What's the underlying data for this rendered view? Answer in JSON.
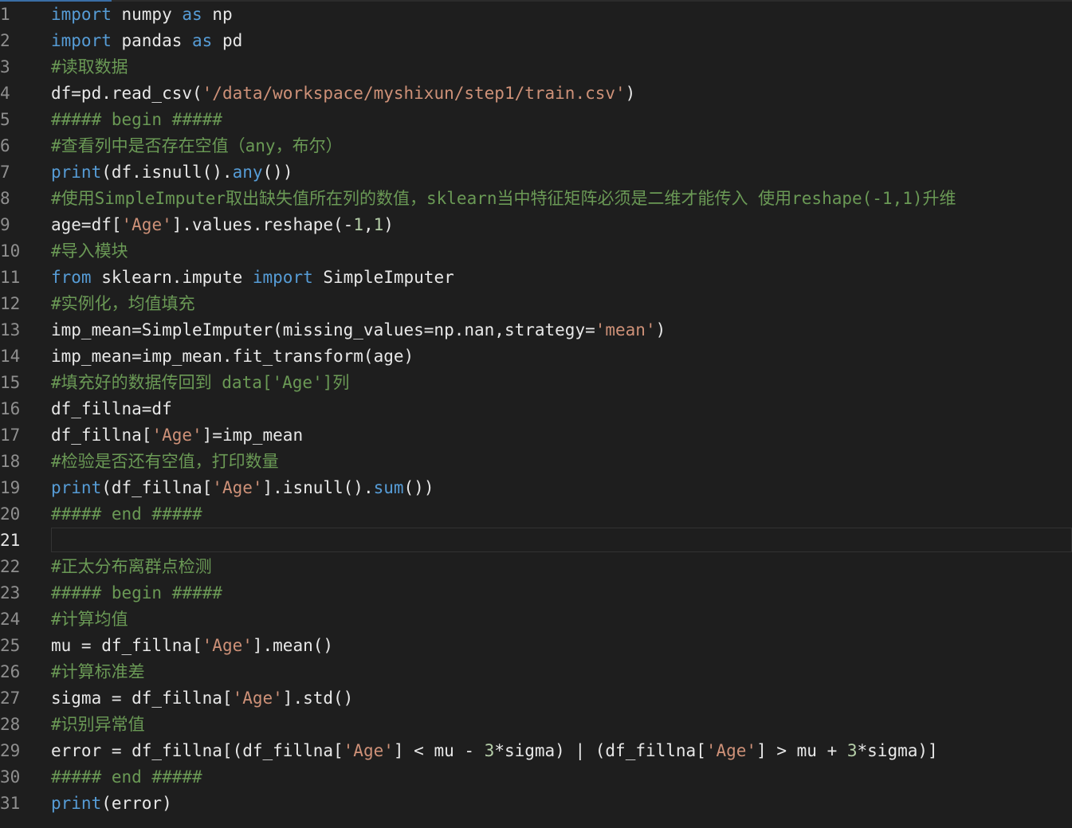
{
  "editor": {
    "current_line": 21,
    "lines": [
      {
        "n": "1",
        "tokens": [
          [
            "kw",
            "import"
          ],
          [
            "plain",
            " numpy "
          ],
          [
            "kw",
            "as"
          ],
          [
            "plain",
            " np"
          ]
        ]
      },
      {
        "n": "2",
        "tokens": [
          [
            "kw",
            "import"
          ],
          [
            "plain",
            " pandas "
          ],
          [
            "kw",
            "as"
          ],
          [
            "plain",
            " pd"
          ]
        ]
      },
      {
        "n": "3",
        "tokens": [
          [
            "cm",
            "#读取数据"
          ]
        ]
      },
      {
        "n": "4",
        "tokens": [
          [
            "plain",
            "df=pd.read_csv("
          ],
          [
            "str",
            "'/data/workspace/myshixun/step1/train.csv'"
          ],
          [
            "plain",
            ")"
          ]
        ]
      },
      {
        "n": "5",
        "tokens": [
          [
            "cm",
            "##### begin #####"
          ]
        ]
      },
      {
        "n": "6",
        "tokens": [
          [
            "cm",
            "#查看列中是否存在空值（any，布尔）"
          ]
        ]
      },
      {
        "n": "7",
        "tokens": [
          [
            "fn",
            "print"
          ],
          [
            "plain",
            "(df.isnull()."
          ],
          [
            "fn",
            "any"
          ],
          [
            "plain",
            "())"
          ]
        ]
      },
      {
        "n": "8",
        "tokens": [
          [
            "cm",
            "#使用SimpleImputer取出缺失值所在列的数值，sklearn当中特征矩阵必须是二维才能传入 使用reshape(-1,1)升维"
          ]
        ]
      },
      {
        "n": "9",
        "tokens": [
          [
            "plain",
            "age=df["
          ],
          [
            "str",
            "'Age'"
          ],
          [
            "plain",
            "].values.reshape(-"
          ],
          [
            "num",
            "1"
          ],
          [
            "plain",
            ","
          ],
          [
            "num",
            "1"
          ],
          [
            "plain",
            ")"
          ]
        ]
      },
      {
        "n": "10",
        "tokens": [
          [
            "cm",
            "#导入模块"
          ]
        ]
      },
      {
        "n": "11",
        "tokens": [
          [
            "kw",
            "from"
          ],
          [
            "plain",
            " sklearn.impute "
          ],
          [
            "kw",
            "import"
          ],
          [
            "plain",
            " SimpleImputer"
          ]
        ]
      },
      {
        "n": "12",
        "tokens": [
          [
            "cm",
            "#实例化，均值填充"
          ]
        ]
      },
      {
        "n": "13",
        "tokens": [
          [
            "plain",
            "imp_mean=SimpleImputer(missing_values=np.nan,strategy="
          ],
          [
            "str",
            "'mean'"
          ],
          [
            "plain",
            ")"
          ]
        ]
      },
      {
        "n": "14",
        "tokens": [
          [
            "plain",
            "imp_mean=imp_mean.fit_transform(age)"
          ]
        ]
      },
      {
        "n": "15",
        "tokens": [
          [
            "cm",
            "#填充好的数据传回到 data['Age']列"
          ]
        ]
      },
      {
        "n": "16",
        "tokens": [
          [
            "plain",
            "df_fillna=df"
          ]
        ]
      },
      {
        "n": "17",
        "tokens": [
          [
            "plain",
            "df_fillna["
          ],
          [
            "str",
            "'Age'"
          ],
          [
            "plain",
            "]=imp_mean"
          ]
        ]
      },
      {
        "n": "18",
        "tokens": [
          [
            "cm",
            "#检验是否还有空值，打印数量"
          ]
        ]
      },
      {
        "n": "19",
        "tokens": [
          [
            "fn",
            "print"
          ],
          [
            "plain",
            "(df_fillna["
          ],
          [
            "str",
            "'Age'"
          ],
          [
            "plain",
            "].isnull()."
          ],
          [
            "fn",
            "sum"
          ],
          [
            "plain",
            "())"
          ]
        ]
      },
      {
        "n": "20",
        "tokens": [
          [
            "cm",
            "##### end #####"
          ]
        ]
      },
      {
        "n": "21",
        "tokens": []
      },
      {
        "n": "22",
        "tokens": [
          [
            "cm",
            "#正太分布离群点检测"
          ]
        ]
      },
      {
        "n": "23",
        "tokens": [
          [
            "cm",
            "##### begin #####"
          ]
        ]
      },
      {
        "n": "24",
        "tokens": [
          [
            "cm",
            "#计算均值"
          ]
        ]
      },
      {
        "n": "25",
        "tokens": [
          [
            "plain",
            "mu = df_fillna["
          ],
          [
            "str",
            "'Age'"
          ],
          [
            "plain",
            "].mean()"
          ]
        ]
      },
      {
        "n": "26",
        "tokens": [
          [
            "cm",
            "#计算标准差"
          ]
        ]
      },
      {
        "n": "27",
        "tokens": [
          [
            "plain",
            "sigma = df_fillna["
          ],
          [
            "str",
            "'Age'"
          ],
          [
            "plain",
            "].std()"
          ]
        ]
      },
      {
        "n": "28",
        "tokens": [
          [
            "cm",
            "#识别异常值"
          ]
        ]
      },
      {
        "n": "29",
        "tokens": [
          [
            "plain",
            "error = df_fillna[(df_fillna["
          ],
          [
            "str",
            "'Age'"
          ],
          [
            "plain",
            "] < mu - "
          ],
          [
            "num",
            "3"
          ],
          [
            "plain",
            "*sigma) | (df_fillna["
          ],
          [
            "str",
            "'Age'"
          ],
          [
            "plain",
            "] > mu + "
          ],
          [
            "num",
            "3"
          ],
          [
            "plain",
            "*sigma)]"
          ]
        ]
      },
      {
        "n": "30",
        "tokens": [
          [
            "cm",
            "##### end #####"
          ]
        ]
      },
      {
        "n": "31",
        "tokens": [
          [
            "fn",
            "print"
          ],
          [
            "plain",
            "(error)"
          ]
        ]
      }
    ]
  },
  "colors": {
    "background": "#1e1e1e",
    "keyword": "#569cd6",
    "string": "#ce9178",
    "comment": "#6a9955",
    "number": "#b5cea8",
    "text": "#e8e8e8",
    "line_number": "#8f8f8f"
  }
}
